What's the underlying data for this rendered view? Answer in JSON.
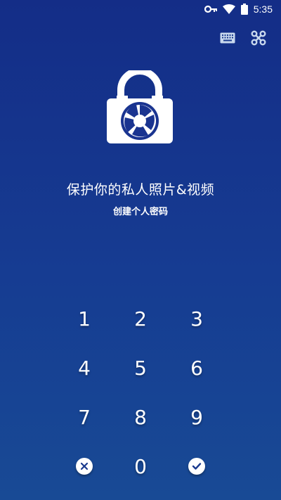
{
  "status_bar": {
    "time": "5:35",
    "icons": [
      "key-icon",
      "wifi-icon",
      "battery-icon"
    ]
  },
  "top_actions": {
    "icons": [
      "keyboard-icon",
      "pattern-icon"
    ]
  },
  "logo": {
    "icon": "lock-camera-shutter-icon"
  },
  "headline": "保护你的私人照片&视频",
  "subline": "创建个人密码",
  "keypad": {
    "keys": [
      "1",
      "2",
      "3",
      "4",
      "5",
      "6",
      "7",
      "8",
      "9",
      "0"
    ],
    "clear_icon": "clear-icon",
    "confirm_icon": "check-icon"
  },
  "colors": {
    "background_top": "#142d87",
    "background_bottom": "#184a95",
    "icon_fill": "#dce8f5",
    "text": "#ffffff"
  }
}
